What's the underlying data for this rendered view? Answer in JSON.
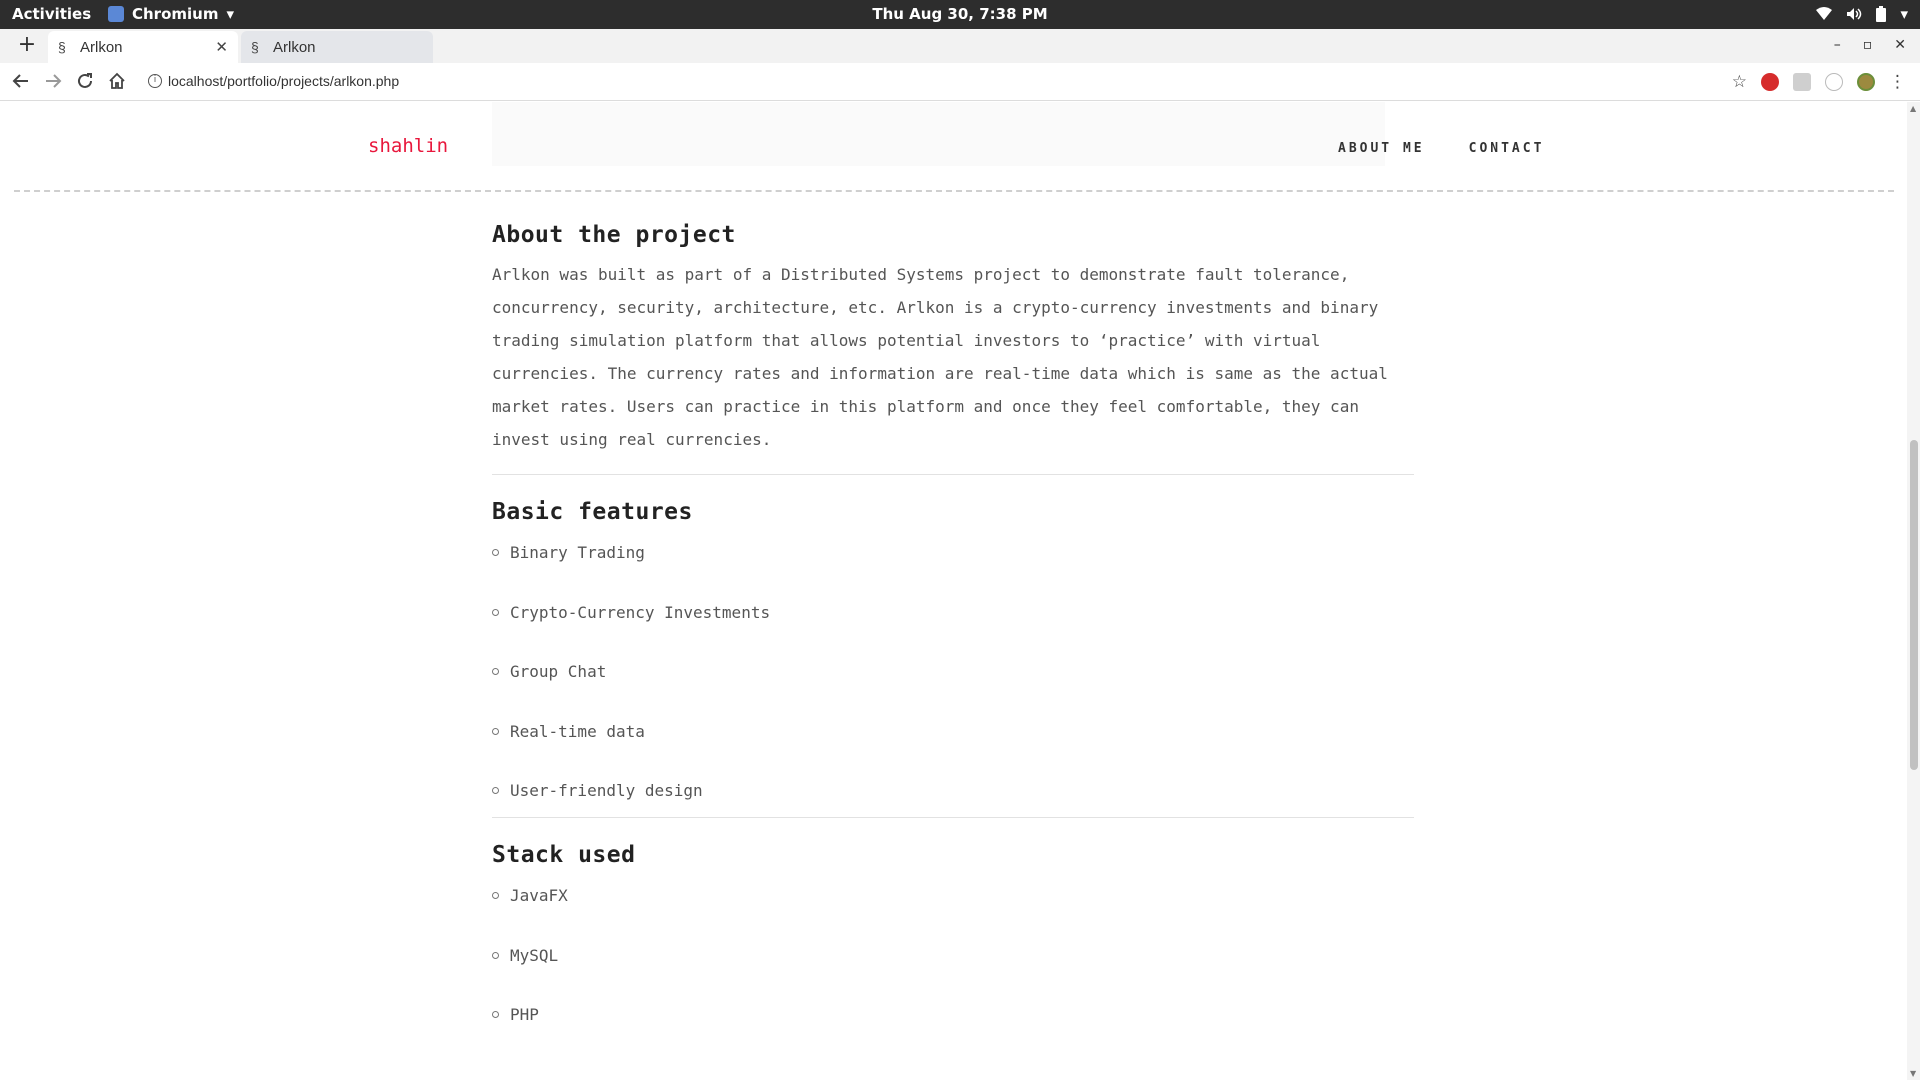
{
  "topbar": {
    "activities": "Activities",
    "app_name": "Chromium",
    "clock": "Thu Aug 30,  7:38 PM"
  },
  "tabs": [
    {
      "label": "Arlkon",
      "active": true
    },
    {
      "label": "Arlkon",
      "active": false
    }
  ],
  "toolbar": {
    "url": "localhost/portfolio/projects/arlkon.php",
    "info_glyph": "i"
  },
  "site": {
    "logo": "shahlin",
    "nav": [
      "ABOUT ME",
      "CONTACT"
    ],
    "accent_color": "#e8173c"
  },
  "sections": {
    "about": {
      "heading": "About the project",
      "body": "Arlkon was built as part of a Distributed Systems project to demonstrate fault tolerance, concurrency, security, architecture, etc. Arlkon is a crypto-currency investments and binary trading simulation platform that allows potential investors to ‘practice’ with virtual currencies. The currency rates and information are real-time data which is same as the actual market rates. Users can practice in this platform and once they feel comfortable, they can invest using real currencies."
    },
    "features": {
      "heading": "Basic features",
      "items": [
        "Binary Trading",
        "Crypto-Currency Investments",
        "Group Chat",
        "Real-time data",
        "User-friendly design"
      ]
    },
    "stack": {
      "heading": "Stack used",
      "items": [
        "JavaFX",
        "MySQL",
        "PHP"
      ]
    }
  }
}
